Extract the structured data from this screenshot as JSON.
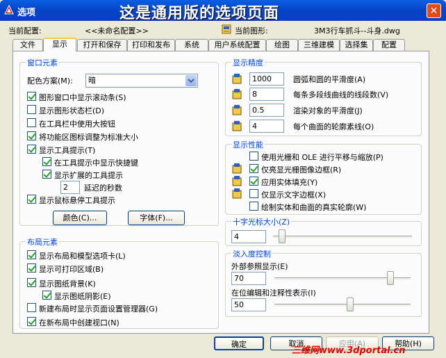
{
  "window": {
    "title": "选项",
    "banner": "这是通用版的选项页面",
    "close_glyph": "✕"
  },
  "header": {
    "config_label": "当前配置:",
    "config_value": "<<未命名配置>>",
    "drawing_label": "当前图形:",
    "drawing_value": "3M3行车抓斗--斗身.dwg"
  },
  "tabs": [
    "文件",
    "显示",
    "打开和保存",
    "打印和发布",
    "系统",
    "用户系统配置",
    "绘图",
    "三维建模",
    "选择集",
    "配置"
  ],
  "window_elements": {
    "title": "窗口元素",
    "color_scheme_label": "配色方案(M):",
    "color_scheme_value": "暗",
    "items": [
      {
        "label": "图形窗口中显示滚动条(S)",
        "checked": true
      },
      {
        "label": "显示图形状态栏(D)",
        "checked": false
      },
      {
        "label": "在工具栏中使用大按钮",
        "checked": false
      },
      {
        "label": "将功能区图标调整为标准大小",
        "checked": true
      },
      {
        "label": "显示工具提示(T)",
        "checked": true
      },
      {
        "label": "在工具提示中显示快捷键",
        "checked": true
      },
      {
        "label": "显示扩展的工具提示",
        "checked": true
      }
    ],
    "delay_value": "2",
    "delay_label": "延迟的秒数",
    "hover_label": "显示鼠标悬停工具提示",
    "hover_checked": true,
    "colors_btn": "颜色(C)...",
    "fonts_btn": "字体(F)..."
  },
  "layout_elements": {
    "title": "布局元素",
    "items": [
      {
        "label": "显示布局和模型选项卡(L)",
        "checked": true
      },
      {
        "label": "显示可打印区域(B)",
        "checked": true
      },
      {
        "label": "显示图纸背景(K)",
        "checked": true
      },
      {
        "label": "显示图纸阴影(E)",
        "checked": true
      },
      {
        "label": "新建布局时显示页面设置管理器(G)",
        "checked": false
      },
      {
        "label": "在新布局中创建视口(N)",
        "checked": true
      }
    ]
  },
  "display_resolution": {
    "title": "显示精度",
    "rows": [
      {
        "value": "1000",
        "label": "圆弧和圆的平滑度(A)"
      },
      {
        "value": "8",
        "label": "每条多段线曲线的线段数(V)"
      },
      {
        "value": "0.5",
        "label": "渲染对象的平滑度(J)"
      },
      {
        "value": "4",
        "label": "每个曲面的轮廓素线(O)"
      }
    ]
  },
  "display_performance": {
    "title": "显示性能",
    "items": [
      {
        "label": "使用光栅和 OLE 进行平移与缩放(P)",
        "checked": false
      },
      {
        "label": "仅亮显光栅图像边框(R)",
        "checked": true
      },
      {
        "label": "应用实体填充(Y)",
        "checked": true
      },
      {
        "label": "仅显示文字边框(X)",
        "checked": false
      },
      {
        "label": "绘制实体和曲面的真实轮廓(W)",
        "checked": false
      }
    ]
  },
  "crosshair": {
    "title": "十字光标大小(Z)",
    "value": "4",
    "level_percent": 4
  },
  "fade": {
    "title": "淡入度控制",
    "xref_label": "外部参照显示(E)",
    "xref_value": "70",
    "xref_percent": 70,
    "inplace_label": "在位编辑和注释性表示(I)",
    "inplace_value": "50",
    "inplace_percent": 50
  },
  "footer": {
    "ok": "确定",
    "cancel": "取消",
    "apply": "应用(A)",
    "help": "帮助(H)"
  },
  "watermark": "三维网www.3dportal.cn"
}
